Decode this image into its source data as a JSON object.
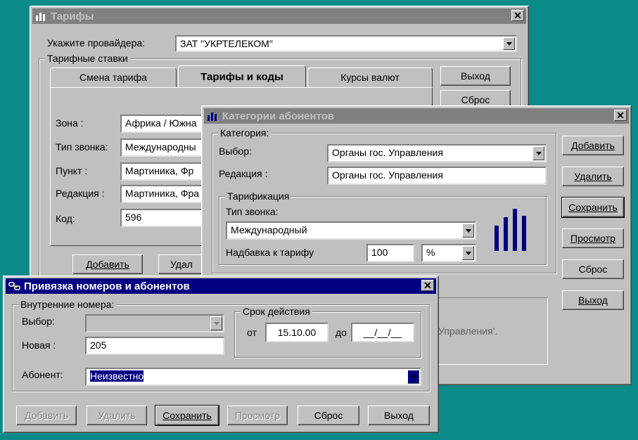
{
  "tariffs": {
    "title": "Тарифы",
    "provider_label": "Укажите провайдера:",
    "provider_value": "ЗАТ \"УКРТЕЛЕКОМ\"",
    "group_label": "Тарифные ставки",
    "tabs": [
      "Смена тарифа",
      "Тарифы и коды",
      "Курсы валют"
    ],
    "zone_label": "Зона :",
    "zone_value": "Африка / Южна",
    "call_type_label": "Тип звонка:",
    "call_type_value": "Международны",
    "point_label": "Пункт :",
    "point_value": "Мартиника, Фр",
    "edition_label": "Редакция :",
    "edition_value": "Мартиника, Фра",
    "code_label": "Код:",
    "code_value": "596",
    "add_button": "Добавить",
    "delete_button_partial": "Удал",
    "exit_button": "Выход",
    "reset_button": "Сброс"
  },
  "categories": {
    "title": "Категории абонентов",
    "category_group": "Категория:",
    "choice_label": "Выбор:",
    "choice_value": "Органы гос. Управления",
    "edition_label": "Редакция :",
    "edition_value": "Органы гос. Управления",
    "tariff_group": "Тарификация",
    "call_type_label": "Тип звонка:",
    "call_type_value": "Международный",
    "markup_label": "Надбавка к тарифу",
    "markup_value": "100",
    "markup_unit": "%",
    "bottom_text": "Управления'.",
    "buttons": {
      "add": "Добавить",
      "delete": "Удалить",
      "save": "Сохранить",
      "view": "Просмотр",
      "reset": "Сброс",
      "exit": "Выход"
    }
  },
  "binding": {
    "title": "Привязка номеров и абонентов",
    "internal_group": "Внутренние номера:",
    "choice_label": "Выбор:",
    "choice_value": "",
    "new_label": "Новая :",
    "new_value": "205",
    "validity_group": "Срок действия",
    "from_label": "от",
    "from_value": "15.10.00",
    "to_label": "до",
    "to_value": "__/__/__",
    "subscriber_label": "Абонент:",
    "subscriber_value": "Неизвестно",
    "buttons": {
      "add": "Добавить",
      "delete": "Удалить",
      "save": "Сохранить",
      "view": "Просмотр",
      "reset": "Сброс",
      "exit": "Выход"
    }
  }
}
